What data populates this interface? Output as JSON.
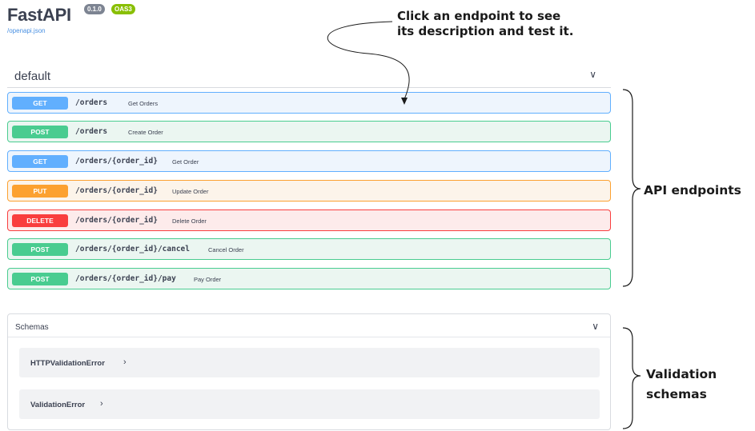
{
  "header": {
    "title": "FastAPI",
    "version_badge": "0.1.0",
    "oas_badge": "OAS3",
    "spec_link": "/openapi.json"
  },
  "annotations": {
    "top_line1": "Click an endpoint to see",
    "top_line2": "its description and test it.",
    "endpoints": "API endpoints",
    "schemas_line1": "Validation",
    "schemas_line2": "schemas"
  },
  "default_section": {
    "title": "default",
    "operations": [
      {
        "method": "GET",
        "path": "/orders",
        "summary": "Get Orders"
      },
      {
        "method": "POST",
        "path": "/orders",
        "summary": "Create Order"
      },
      {
        "method": "GET",
        "path": "/orders/{order_id}",
        "summary": "Get Order"
      },
      {
        "method": "PUT",
        "path": "/orders/{order_id}",
        "summary": "Update Order"
      },
      {
        "method": "DELETE",
        "path": "/orders/{order_id}",
        "summary": "Delete Order"
      },
      {
        "method": "POST",
        "path": "/orders/{order_id}/cancel",
        "summary": "Cancel Order"
      },
      {
        "method": "POST",
        "path": "/orders/{order_id}/pay",
        "summary": "Pay Order"
      }
    ]
  },
  "schemas_section": {
    "title": "Schemas",
    "items": [
      {
        "name": "HTTPValidationError"
      },
      {
        "name": "ValidationError"
      }
    ]
  },
  "icons": {
    "expand": "chevron-down-icon",
    "schema_expand": "chevron-right-icon"
  },
  "colors": {
    "get": "#61affe",
    "post": "#49cc90",
    "put": "#fca130",
    "delete": "#f93e3e",
    "link": "#4990e2",
    "oas_badge": "#89bf04"
  }
}
